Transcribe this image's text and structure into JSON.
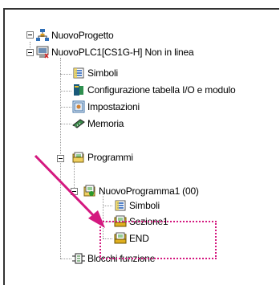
{
  "tree": {
    "project": {
      "label": "NuovoProgetto",
      "icon": "project-network-icon"
    },
    "plc": {
      "label": "NuovoPLC1[CS1G-H] Non in linea",
      "icon": "plc-icon"
    },
    "plc_children": [
      {
        "label": "Simboli",
        "icon": "symbols-icon"
      },
      {
        "label": "Configurazione tabella I/O e modulo",
        "icon": "io-table-icon"
      },
      {
        "label": "Impostazioni",
        "icon": "settings-icon"
      },
      {
        "label": "Memoria",
        "icon": "memory-icon"
      },
      {
        "label": "Programmi",
        "icon": "programs-icon"
      }
    ],
    "program": {
      "label": "NuovoProgramma1 (00)",
      "icon": "program-icon"
    },
    "program_children": [
      {
        "label": "Simboli",
        "icon": "symbols-icon"
      },
      {
        "label": "Sezione1",
        "icon": "section-icon"
      },
      {
        "label": "END",
        "icon": "section-icon"
      }
    ],
    "function_blocks": {
      "label": "Blocchi funzione",
      "icon": "function-block-icon"
    }
  },
  "colors": {
    "annotation": "#d4187f",
    "tree_lines": "#9a9a9a"
  }
}
